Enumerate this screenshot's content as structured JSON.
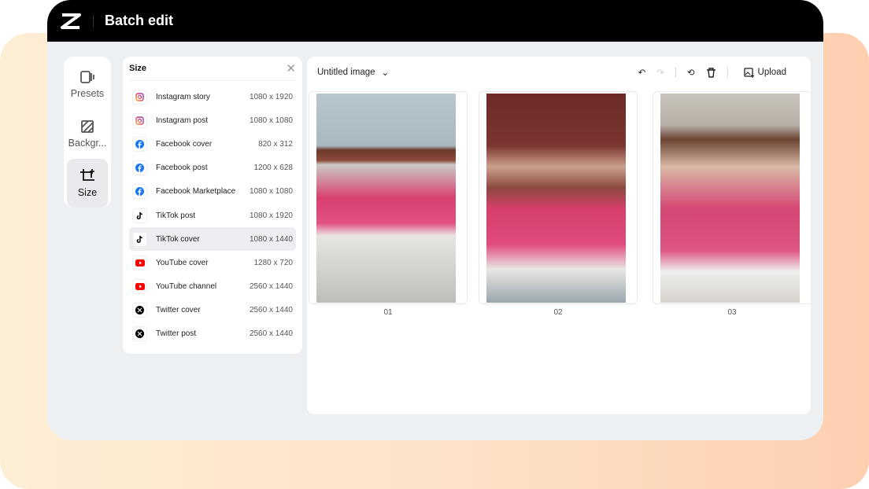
{
  "header": {
    "title": "Batch edit"
  },
  "rail": [
    {
      "label": "Presets",
      "icon": "presets-icon"
    },
    {
      "label": "Backgr...",
      "icon": "background-icon"
    },
    {
      "label": "Size",
      "icon": "crop-icon",
      "active": true
    }
  ],
  "size_panel": {
    "title": "Size",
    "items": [
      {
        "name": "Instagram story",
        "dims": "1080 x 1920",
        "platform": "instagram"
      },
      {
        "name": "Instagram post",
        "dims": "1080 x 1080",
        "platform": "instagram"
      },
      {
        "name": "Facebook cover",
        "dims": "820 x 312",
        "platform": "facebook"
      },
      {
        "name": "Facebook post",
        "dims": "1200 x 628",
        "platform": "facebook"
      },
      {
        "name": "Facebook Marketplace",
        "dims": "1080 x 1080",
        "platform": "facebook"
      },
      {
        "name": "TikTok post",
        "dims": "1080 x 1920",
        "platform": "tiktok"
      },
      {
        "name": "TikTok cover",
        "dims": "1080 x 1440",
        "platform": "tiktok",
        "selected": true
      },
      {
        "name": "YouTube cover",
        "dims": "1280 x 720",
        "platform": "youtube"
      },
      {
        "name": "YouTube channel",
        "dims": "2560 x 1440",
        "platform": "youtube"
      },
      {
        "name": "Twitter cover",
        "dims": "2560 x 1440",
        "platform": "x"
      },
      {
        "name": "Twitter post",
        "dims": "2560 x 1440",
        "platform": "x"
      }
    ]
  },
  "main": {
    "file_name": "Untitled image",
    "upload_label": "Upload",
    "images": [
      {
        "label": "01"
      },
      {
        "label": "02"
      },
      {
        "label": "03"
      }
    ]
  },
  "colors": {
    "instagram": "#e1306c",
    "facebook": "#1877f2",
    "youtube": "#ff0000",
    "tiktok": "#000000",
    "x": "#000000"
  }
}
